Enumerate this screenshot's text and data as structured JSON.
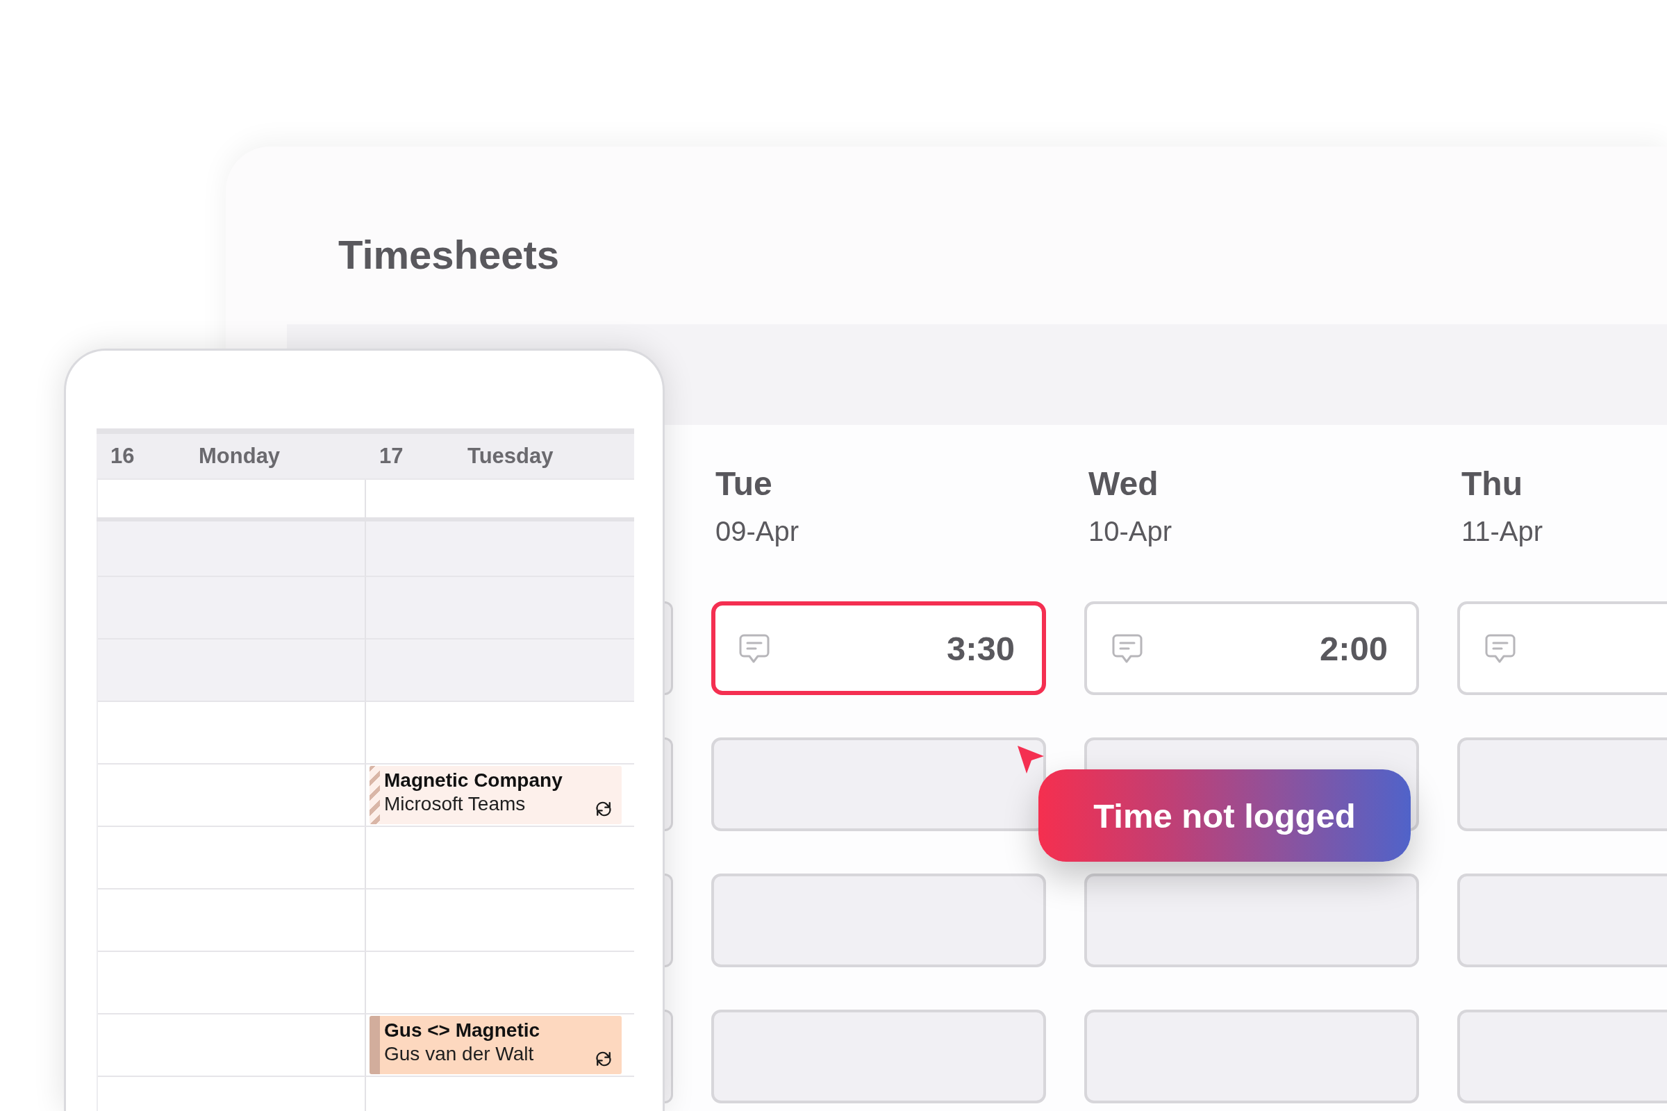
{
  "app": {
    "title": "Timesheets"
  },
  "timesheet": {
    "days": [
      {
        "weekday": "Tue",
        "date": "09-Apr"
      },
      {
        "weekday": "Wed",
        "date": "10-Apr"
      },
      {
        "weekday": "Thu",
        "date": "11-Apr"
      }
    ],
    "rows": [
      {
        "cells": [
          {
            "time": "3:30",
            "active": true,
            "flagged": true
          },
          {
            "time": "2:00",
            "active": true,
            "flagged": false
          },
          {
            "active": true,
            "flagged": false
          }
        ]
      },
      {
        "cells": [
          {
            "active": false,
            "flagged": false
          },
          {
            "active": false,
            "flagged": false
          },
          {
            "active": false,
            "flagged": false
          }
        ]
      },
      {
        "cells": [
          {
            "active": false,
            "flagged": false
          },
          {
            "active": false,
            "flagged": false
          },
          {
            "active": false,
            "flagged": false
          }
        ]
      },
      {
        "cells": [
          {
            "active": false,
            "flagged": false
          },
          {
            "active": false,
            "flagged": false
          },
          {
            "active": false,
            "flagged": false
          }
        ]
      }
    ]
  },
  "tooltip": {
    "text": "Time not logged"
  },
  "calendar": {
    "days": [
      {
        "number": "16",
        "name": "Monday"
      },
      {
        "number": "17",
        "name": "Tuesday"
      }
    ],
    "slots": [
      {
        "cells": [
          {
            "shaded": true
          },
          {
            "shaded": true
          }
        ]
      },
      {
        "cells": [
          {
            "shaded": true
          },
          {
            "shaded": true
          }
        ]
      },
      {
        "cells": [
          {
            "shaded": true
          },
          {
            "shaded": true
          }
        ]
      },
      {
        "cells": [
          {
            "shaded": false
          },
          {
            "shaded": false
          }
        ]
      },
      {
        "cells": [
          {
            "shaded": false
          },
          {
            "shaded": false,
            "event": {
              "title": "Magnetic Company",
              "subtitle": "Microsoft Teams",
              "kind": "tentative",
              "recurring": true
            }
          }
        ]
      },
      {
        "cells": [
          {
            "shaded": false
          },
          {
            "shaded": false
          }
        ]
      },
      {
        "cells": [
          {
            "shaded": false
          },
          {
            "shaded": false
          }
        ]
      },
      {
        "cells": [
          {
            "shaded": false
          },
          {
            "shaded": false
          }
        ]
      },
      {
        "cells": [
          {
            "shaded": false
          },
          {
            "shaded": false,
            "event": {
              "title": "Gus <> Magnetic",
              "subtitle": "Gus van der Walt",
              "kind": "accepted",
              "recurring": true
            }
          }
        ]
      },
      {
        "cells": [
          {
            "shaded": false
          },
          {
            "shaded": false
          }
        ]
      }
    ]
  }
}
